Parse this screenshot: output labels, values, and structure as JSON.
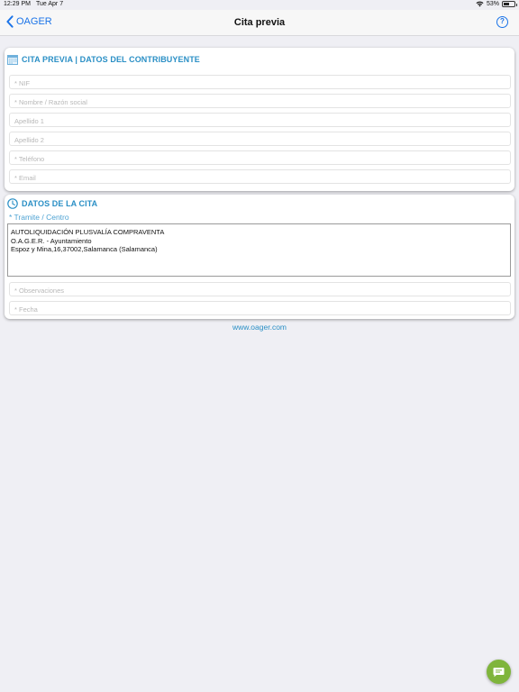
{
  "status_bar": {
    "time": "12:29 PM",
    "date": "Tue Apr 7",
    "battery_text": "53%",
    "battery_level": 0.53
  },
  "nav": {
    "back_label": "OAGER",
    "title": "Cita previa",
    "help_label": "?"
  },
  "contribuyente": {
    "header": "CITA PREVIA | DATOS DEL CONTRIBUYENTE",
    "icon": "calendar-icon",
    "fields": [
      {
        "placeholder": "* NIF"
      },
      {
        "placeholder": "* Nombre / Razón social"
      },
      {
        "placeholder": "Apellido 1"
      },
      {
        "placeholder": "Apellido 2"
      },
      {
        "placeholder": "* Teléfono"
      },
      {
        "placeholder": "* Email"
      }
    ]
  },
  "cita": {
    "header": "DATOS DE LA CITA",
    "icon": "clock-icon",
    "tramite_label": "* Tramite / Centro",
    "tramite_lines": [
      "AUTOLIQUIDACIÓN PLUSVALÍA  COMPRAVENTA",
      "O.A.G.E.R. - Ayuntamiento",
      "Espoz y Mina,16,37002,Salamanca (Salamanca)"
    ],
    "fields": [
      {
        "placeholder": "* Observaciones"
      },
      {
        "placeholder": "* Fecha"
      }
    ]
  },
  "footer": {
    "link": "www.oager.com"
  },
  "colors": {
    "accent": "#2a8fc5",
    "nav_blue": "#1a73e8",
    "fab_green": "#7fb53c",
    "background": "#efeff4"
  }
}
